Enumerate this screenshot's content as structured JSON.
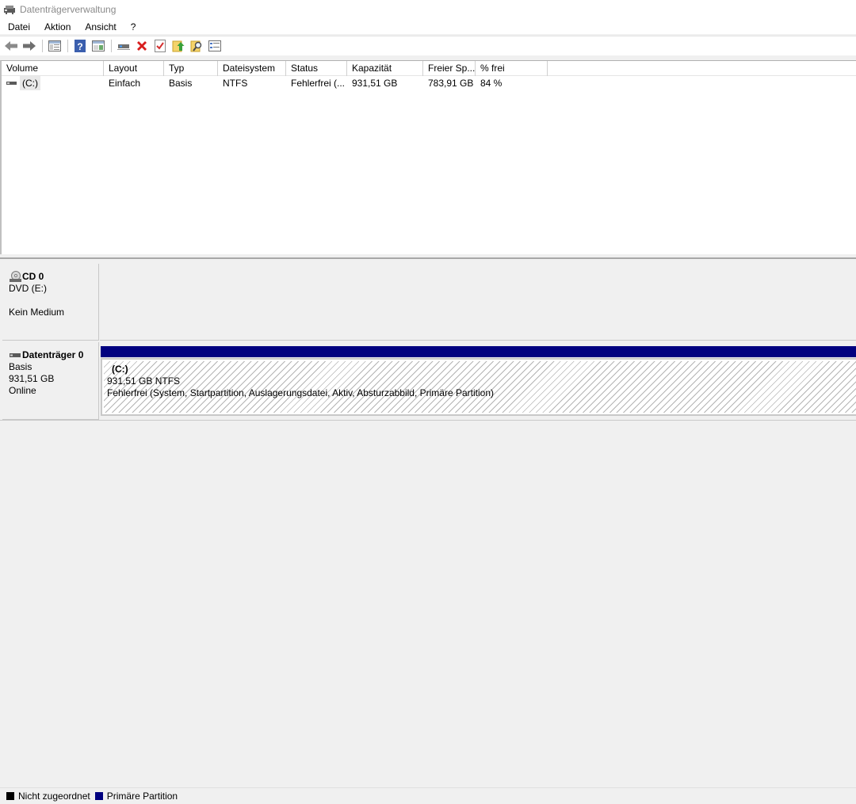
{
  "window": {
    "title": "Datenträgerverwaltung"
  },
  "menu": [
    "Datei",
    "Aktion",
    "Ansicht",
    "?"
  ],
  "toolbar": {
    "icons": [
      "back-icon",
      "forward-icon",
      "console-tree-icon",
      "help-icon",
      "properties-view-icon",
      "connect-drive-icon",
      "delete-icon",
      "check-icon",
      "export-icon",
      "search-icon",
      "list-icon"
    ]
  },
  "volume_table": {
    "columns": [
      "Volume",
      "Layout",
      "Typ",
      "Dateisystem",
      "Status",
      "Kapazität",
      "Freier Sp...",
      "% frei"
    ],
    "rows": [
      {
        "volume": "(C:)",
        "layout": "Einfach",
        "typ": "Basis",
        "dateisystem": "NTFS",
        "status": "Fehlerfrei (...",
        "kapazitaet": "931,51 GB",
        "freier": "783,91 GB",
        "frei_pct": "84 %"
      }
    ]
  },
  "disks": {
    "cd0": {
      "name": "CD 0",
      "line1": "DVD (E:)",
      "line2": "Kein Medium"
    },
    "disk0": {
      "name": "Datenträger 0",
      "type": "Basis",
      "size": "931,51 GB",
      "state": "Online",
      "partition": {
        "name": "(C:)",
        "size_fs": "931,51 GB NTFS",
        "status": "Fehlerfrei (System, Startpartition, Auslagerungsdatei, Aktiv, Absturzabbild, Primäre Partition)",
        "header_color": "#00007f"
      }
    }
  },
  "legend": [
    {
      "label": "Nicht zugeordnet",
      "color": "#000000"
    },
    {
      "label": "Primäre Partition",
      "color": "#00007f"
    }
  ]
}
